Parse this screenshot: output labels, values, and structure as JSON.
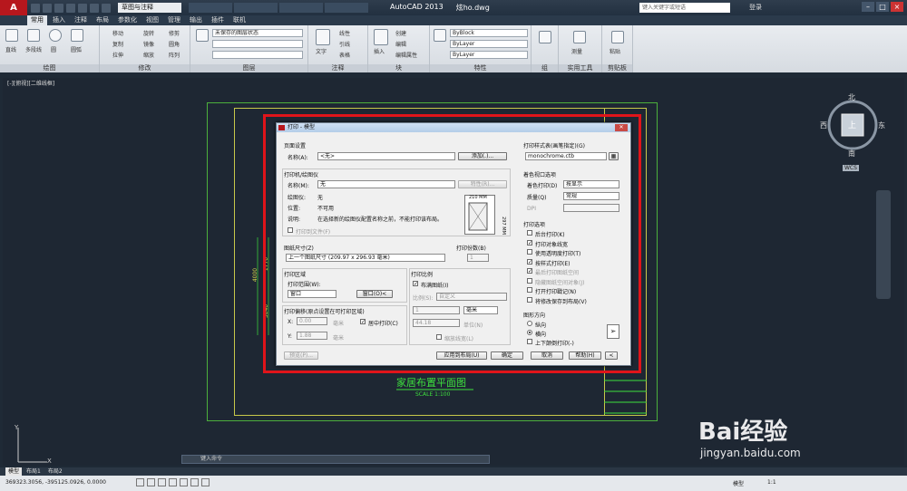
{
  "titlebar": {
    "workspace": "草图与注释",
    "app": "AutoCAD 2013",
    "file": "炫ho.dwg",
    "search_placeholder": "键入关键字或短语",
    "login": "登录",
    "tabs": [
      "",
      "",
      "",
      "",
      "",
      ""
    ]
  },
  "menu": [
    "常用",
    "插入",
    "注释",
    "布局",
    "参数化",
    "视图",
    "管理",
    "输出",
    "插件",
    "联机",
    ""
  ],
  "ribbon": {
    "draw": {
      "label": "绘图",
      "items": [
        "直线",
        "多段线",
        "圆",
        "圆弧"
      ]
    },
    "modify": {
      "label": "修改",
      "items": [
        "移动",
        "旋转",
        "修剪",
        "复制",
        "镜像",
        "圆角",
        "拉伸",
        "缩放",
        "阵列"
      ]
    },
    "layers": {
      "label": "图层",
      "state": "未保存的图层状态"
    },
    "annotation": {
      "label": "注释",
      "items": [
        "文字",
        "标注",
        "线性",
        "引线",
        "表格"
      ]
    },
    "block": {
      "label": "块",
      "items": [
        "插入",
        "创建",
        "编辑",
        "编辑属性"
      ]
    },
    "properties": {
      "label": "特性",
      "color": "ByBlock",
      "linetype": "ByLayer",
      "lineweight": "ByLayer"
    },
    "groups": {
      "label": "组"
    },
    "utilities": {
      "label": "实用工具",
      "items": [
        "测量"
      ]
    },
    "clipboard": {
      "label": "剪贴板",
      "items": [
        "粘贴"
      ]
    }
  },
  "viewport_label": "[-][俯视][二维线框]",
  "dialog": {
    "title": "打印 - 模型",
    "page_setup": {
      "label": "页面设置",
      "name_label": "名称(A):",
      "name_value": "<无>",
      "add_btn": "添加(.)..."
    },
    "printer": {
      "label": "打印机/绘图仪",
      "name_label": "名称(M):",
      "name_value": "无",
      "props_btn": "特性(R)...",
      "plotter_label": "绘图仪:",
      "plotter_value": "无",
      "where_label": "位置:",
      "where_value": "不可用",
      "desc_label": "说明:",
      "desc_value": "在选择新的绘图仪配置名称之前，不能打印该布局。",
      "to_file": "打印到文件(F)",
      "preview_w": "210 MM",
      "preview_h": "297 MM"
    },
    "paper": {
      "label": "图纸尺寸(Z)",
      "value": "上一个图纸尺寸 (209.97 x 296.93 毫米)"
    },
    "copies": {
      "label": "打印份数(B)",
      "value": "1"
    },
    "area": {
      "label": "打印区域",
      "range_label": "打印范围(W):",
      "range_value": "窗口",
      "window_btn": "窗口(O)<"
    },
    "scale": {
      "label": "打印比例",
      "fit": "布满图纸(I)",
      "scale_label": "比例(S):",
      "scale_value": "自定义",
      "v1": "1",
      "unit": "毫米",
      "v2": "44.18",
      "unit_label": "单位(N)",
      "lw": "缩放线宽(L)"
    },
    "offset": {
      "label": "打印偏移(原点设置在可打印区域)",
      "x_label": "X:",
      "x_value": "0.00",
      "x_unit": "毫米",
      "center": "居中打印(C)",
      "y_label": "Y:",
      "y_value": "1.88",
      "y_unit": "毫米"
    },
    "style": {
      "label": "打印样式表(画笔指定)(G)",
      "value": "monochrome.ctb"
    },
    "shaded": {
      "label": "着色视口选项",
      "shade_label": "着色打印(D)",
      "shade_value": "按显示",
      "quality_label": "质量(Q)",
      "quality_value": "常规",
      "dpi": "DPI"
    },
    "options": {
      "label": "打印选项",
      "items": [
        {
          "t": "后台打印(K)",
          "c": false,
          "d": false
        },
        {
          "t": "打印对象线宽",
          "c": true,
          "d": false
        },
        {
          "t": "使用透明度打印(T)",
          "c": false,
          "d": false
        },
        {
          "t": "按样式打印(E)",
          "c": true,
          "d": false
        },
        {
          "t": "最后打印图纸空间",
          "c": true,
          "d": true
        },
        {
          "t": "隐藏图纸空间对象(J)",
          "c": false,
          "d": true
        },
        {
          "t": "打开打印戳记(N)",
          "c": false,
          "d": false
        },
        {
          "t": "将修改保存到布局(V)",
          "c": false,
          "d": false
        }
      ]
    },
    "orientation": {
      "label": "图形方向",
      "portrait": "纵向",
      "landscape": "横向",
      "upside": "上下颠倒打印(-)"
    },
    "buttons": {
      "preview": "预览(P)...",
      "apply": "应用到布局(U)",
      "ok": "确定",
      "cancel": "取消",
      "help": "帮助(H)"
    }
  },
  "drawing": {
    "title": "家居布置平面图",
    "scale": "SCALE 1:100",
    "dim1": "4000",
    "dim2": "1770",
    "dim3": "5040",
    "dim4": "300"
  },
  "compass": {
    "n": "北",
    "s": "南",
    "e": "东",
    "w": "西",
    "top": "上",
    "wcs": "WCS"
  },
  "command": {
    "placeholder": "键入命令"
  },
  "layout_tabs": [
    "模型",
    "布局1",
    "布局2"
  ],
  "status": {
    "coords": "369323.3056, -395125.0926, 0.0000",
    "model": "模型",
    "scale": "1:1"
  },
  "watermark": {
    "brand": "Bai经验",
    "url": "jingyan.baidu.com"
  },
  "colors": {
    "accent": "#b7171d",
    "highlight": "#e0141a",
    "cad_green": "#3ee03e"
  }
}
